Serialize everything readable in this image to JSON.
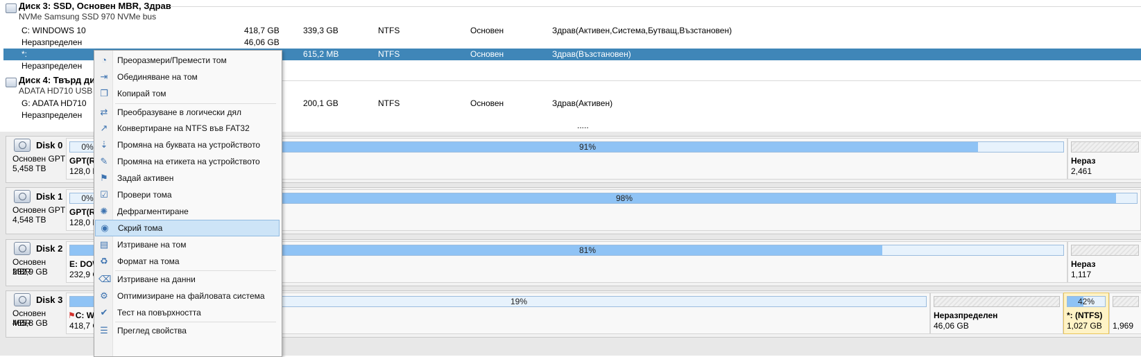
{
  "disk_list": {
    "disk3": {
      "title": "Диск 3: SSD, Основен MBR, Здрав",
      "subtitle": "NVMe Samsung SSD 970 NVMe bus",
      "rows": [
        {
          "name": "C: WINDOWS 10",
          "capacity": "418,7 GB",
          "used": "339,3 GB",
          "fs": "NTFS",
          "type": "Основен",
          "status": "Здрав(Активен,Система,Бутващ,Възстановен)"
        },
        {
          "name": "Неразпределен",
          "capacity": "46,06 GB",
          "used": "",
          "fs": "",
          "type": "",
          "status": ""
        },
        {
          "name": "*:",
          "capacity": "",
          "used": "615,2 MB",
          "fs": "NTFS",
          "type": "Основен",
          "status": "Здрав(Възстановен)"
        },
        {
          "name": "Неразпределен",
          "capacity": "",
          "used": "",
          "fs": "",
          "type": "",
          "status": ""
        }
      ]
    },
    "disk4": {
      "title": "Диск 4: Твърд дис",
      "subtitle": "ADATA HD710 USB",
      "rows": [
        {
          "name": "G: ADATA HD710",
          "capacity": "",
          "used": "200,1 GB",
          "fs": "NTFS",
          "type": "Основен",
          "status": "Здрав(Активен)"
        },
        {
          "name": "Неразпределен",
          "capacity": "",
          "used": "",
          "fs": "",
          "type": "",
          "status": ""
        }
      ],
      "more": "....."
    }
  },
  "disk_map": [
    {
      "name": "Disk 0",
      "type": "Основен GPT",
      "size": "5,458 TB",
      "parts": [
        {
          "pct": "0%",
          "fill": 0,
          "name": "GPT(Re",
          "size": "128,0 M"
        },
        {
          "pct": "91%",
          "fill": 0.91,
          "name": "",
          "size": ""
        },
        {
          "pct": "",
          "fill": 0,
          "name": "Нераз",
          "size": "2,461",
          "un": true
        }
      ]
    },
    {
      "name": "Disk 1",
      "type": "Основен GPT",
      "size": "4,548 TB",
      "parts": [
        {
          "pct": "0%",
          "fill": 0,
          "name": "GPT(Re",
          "size": "128,0 M"
        },
        {
          "pct": "98%",
          "fill": 0.98,
          "name": "",
          "size": ""
        }
      ]
    },
    {
      "name": "Disk 2",
      "type": "Основен MBR",
      "size": "232,9 GB",
      "parts": [
        {
          "pct": "",
          "fill": 1,
          "name": "E: DOW",
          "size": "232,9 G"
        },
        {
          "pct": "81%",
          "fill": 0.81,
          "name": "",
          "size": ""
        },
        {
          "pct": "",
          "fill": 0,
          "name": "Нераз",
          "size": "1,117",
          "un": true
        }
      ]
    },
    {
      "name": "Disk 3",
      "type": "Основен MBR",
      "size": "465,8 GB",
      "parts": [
        {
          "pct": "",
          "fill": 1,
          "name": "C: W",
          "size": "418,7 G"
        },
        {
          "pct": "19%",
          "fill": 0.19,
          "name": "",
          "size": ""
        },
        {
          "pct": "",
          "fill": 0,
          "name": "Неразпределен",
          "size": "46,06 GB",
          "un": true
        },
        {
          "pct": "42%",
          "fill": 0.42,
          "name": "*: (NTFS)",
          "size": "1,027 GB"
        },
        {
          "pct": "",
          "fill": 0,
          "name": "",
          "size": "1,969",
          "un": true
        }
      ]
    }
  ],
  "context_menu": {
    "items": [
      {
        "label": "Преоразмери/Премести том",
        "icon": "resize-icon"
      },
      {
        "label": "Обединяване на том",
        "icon": "merge-icon"
      },
      {
        "label": "Копирай том",
        "icon": "copy-icon"
      },
      {
        "label": "Преобразуване в логически дял",
        "icon": "convert-logical-icon"
      },
      {
        "label": "Конвертиране на NTFS във FAT32",
        "icon": "convert-fs-icon"
      },
      {
        "label": "Промяна на буквата на устройството",
        "icon": "drive-letter-icon"
      },
      {
        "label": "Промяна на етикета на устройството",
        "icon": "edit-label-icon"
      },
      {
        "label": "Задай активен",
        "icon": "flag-icon"
      },
      {
        "label": "Провери тома",
        "icon": "check-icon"
      },
      {
        "label": "Дефрагментиране",
        "icon": "defrag-icon"
      },
      {
        "label": "Скрий тома",
        "icon": "eye-hide-icon"
      },
      {
        "label": "Изтриване на том",
        "icon": "delete-icon"
      },
      {
        "label": "Формат на тома",
        "icon": "format-icon"
      },
      {
        "label": "Изтриване на данни",
        "icon": "eraser-icon"
      },
      {
        "label": "Оптимизиране на файловата система",
        "icon": "optimize-icon"
      },
      {
        "label": "Тест на повърхността",
        "icon": "surface-test-icon"
      },
      {
        "label": "Преглед свойства",
        "icon": "properties-icon"
      }
    ],
    "highlighted": "Скрий тома"
  }
}
